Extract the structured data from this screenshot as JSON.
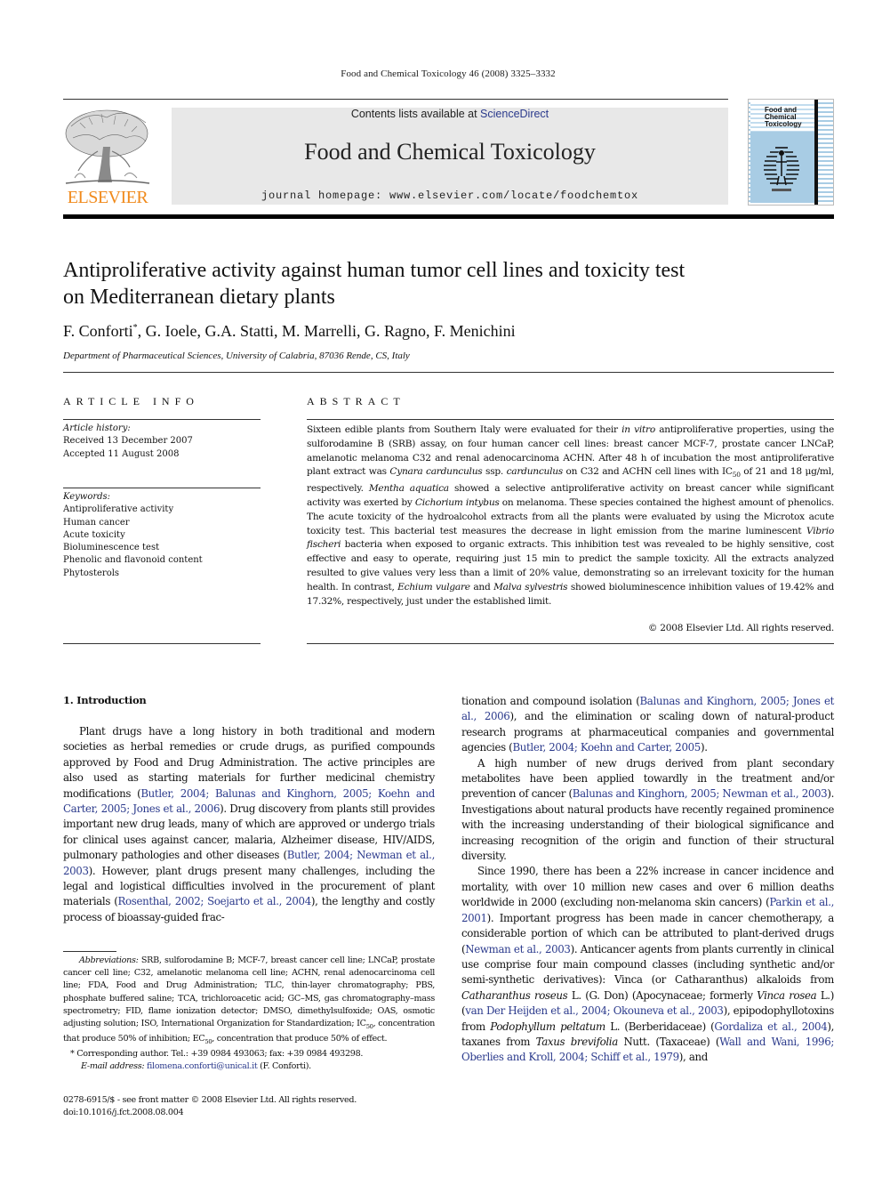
{
  "running_head": "Food and Chemical Toxicology 46 (2008) 3325–3332",
  "masthead": {
    "publisher_logo_text": "ELSEVIER",
    "contents_prefix": "Contents lists available at ",
    "contents_link": "ScienceDirect",
    "journal_title": "Food and Chemical Toxicology",
    "homepage": "journal homepage: www.elsevier.com/locate/foodchemtox",
    "cover_title_lines": [
      "Food and",
      "Chemical",
      "Toxicology"
    ],
    "colors": {
      "elsevier_orange": "#f08a1c",
      "link_blue": "#2b3a8c",
      "cover_blue": "#a8cce4",
      "masthead_gray": "#e8e8e8"
    }
  },
  "article": {
    "title_line1": "Antiproliferative activity against human tumor cell lines and toxicity test",
    "title_line2": "on Mediterranean dietary plants",
    "first_author": "F. Conforti",
    "corresponding_mark": "*",
    "other_authors": ", G. Ioele, G.A. Statti, M. Marrelli, G. Ragno, F. Menichini",
    "affiliation": "Department of Pharmaceutical Sciences, University of Calabria, 87036 Rende, CS, Italy"
  },
  "article_info": {
    "heading": "ARTICLE INFO",
    "history_label": "Article history:",
    "received": "Received 13 December 2007",
    "accepted": "Accepted 11 August 2008",
    "keywords_label": "Keywords:",
    "keywords": [
      "Antiproliferative activity",
      "Human cancer",
      "Acute toxicity",
      "Bioluminescence test",
      "Phenolic and flavonoid content",
      "Phytosterols"
    ]
  },
  "abstract": {
    "heading": "ABSTRACT",
    "segments": [
      {
        "t": "Sixteen edible plants from Southern Italy were evaluated for their "
      },
      {
        "t": "in vitro",
        "i": true
      },
      {
        "t": " antiproliferative properties, using the sulforodamine B (SRB) assay, on four human cancer cell lines: breast cancer MCF-7, prostate cancer LNCaP, amelanotic melanoma C32 and renal adenocarcinoma ACHN. After 48 h of incubation the most antiproliferative plant extract was "
      },
      {
        "t": "Cynara cardunculus",
        "i": true
      },
      {
        "t": " ssp. "
      },
      {
        "t": "cardunculus",
        "i": true
      },
      {
        "t": " on C32 and ACHN cell lines with IC"
      },
      {
        "t": "50",
        "sub": true
      },
      {
        "t": " of 21 and 18 μg/ml, respectively. "
      },
      {
        "t": "Mentha aquatica",
        "i": true
      },
      {
        "t": " showed a selective antiproliferative activity on breast cancer while significant activity was exerted by "
      },
      {
        "t": "Cichorium intybus",
        "i": true
      },
      {
        "t": " on melanoma. These species contained the highest amount of phenolics. The acute toxicity of the hydroalcohol extracts from all the plants were evaluated by using the Microtox acute toxicity test. This bacterial test measures the decrease in light emission from the marine luminescent "
      },
      {
        "t": "Vibrio fischeri",
        "i": true
      },
      {
        "t": " bacteria when exposed to organic extracts. This inhibition test was revealed to be highly sensitive, cost effective and easy to operate, requiring just 15 min to predict the sample toxicity. All the extracts analyzed resulted to give values very less than a limit of 20% value, demonstrating so an irrelevant toxicity for the human health. In contrast, "
      },
      {
        "t": "Echium vulgare",
        "i": true
      },
      {
        "t": " and "
      },
      {
        "t": "Malva sylvestris",
        "i": true
      },
      {
        "t": " showed bioluminescence inhibition values of 19.42% and 17.32%, respectively, just under the established limit."
      }
    ],
    "copyright": "© 2008 Elsevier Ltd. All rights reserved."
  },
  "introduction": {
    "heading": "1. Introduction",
    "left_paragraphs": [
      [
        {
          "t": "Plant drugs have a long history in both traditional and modern societies as herbal remedies or crude drugs, as purified compounds approved by Food and Drug Administration. The active principles are also used as starting materials for further medicinal chemistry modifications ("
        },
        {
          "t": "Butler, 2004; Balunas and Kinghorn, 2005; Koehn and Carter, 2005; Jones et al., 2006",
          "c": true
        },
        {
          "t": "). Drug discovery from plants still provides important new drug leads, many of which are approved or undergo trials for clinical uses against cancer, malaria, Alzheimer disease, HIV/AIDS, pulmonary pathologies and other diseases ("
        },
        {
          "t": "Butler, 2004; Newman et al., 2003",
          "c": true
        },
        {
          "t": "). However, plant drugs present many challenges, including the legal and logistical difficulties involved in the procurement of plant materials ("
        },
        {
          "t": "Rosenthal, 2002; Soejarto et al., 2004",
          "c": true
        },
        {
          "t": "), the lengthy and costly process of bioassay-guided frac-"
        }
      ]
    ],
    "right_paragraphs": [
      {
        "noindent": true,
        "segs": [
          {
            "t": "tionation and compound isolation ("
          },
          {
            "t": "Balunas and Kinghorn, 2005; Jones et al., 2006",
            "c": true
          },
          {
            "t": "), and the elimination or scaling down of natural-product research programs at pharmaceutical companies and governmental agencies ("
          },
          {
            "t": "Butler, 2004; Koehn and Carter, 2005",
            "c": true
          },
          {
            "t": ")."
          }
        ]
      },
      {
        "segs": [
          {
            "t": "A high number of new drugs derived from plant secondary metabolites have been applied towardly in the treatment and/or prevention of cancer ("
          },
          {
            "t": "Balunas and Kinghorn, 2005; Newman et al., 2003",
            "c": true
          },
          {
            "t": "). Investigations about natural products have recently regained prominence with the increasing understanding of their biological significance and increasing recognition of the origin and function of their structural diversity."
          }
        ]
      },
      {
        "segs": [
          {
            "t": "Since 1990, there has been a 22% increase in cancer incidence and mortality, with over 10 million new cases and over 6 million deaths worldwide in 2000 (excluding non-melanoma skin cancers) ("
          },
          {
            "t": "Parkin et al., 2001",
            "c": true
          },
          {
            "t": "). Important progress has been made in cancer chemotherapy, a considerable portion of which can be attributed to plant-derived drugs ("
          },
          {
            "t": "Newman et al., 2003",
            "c": true
          },
          {
            "t": "). Anticancer agents from plants currently in clinical use comprise four main compound classes (including synthetic and/or semi-synthetic derivatives): Vinca (or Catharanthus) alkaloids from "
          },
          {
            "t": "Catharanthus roseus",
            "i": true
          },
          {
            "t": " L. (G. Don) (Apocynaceae; formerly "
          },
          {
            "t": "Vinca rosea",
            "i": true
          },
          {
            "t": " L.) ("
          },
          {
            "t": "van Der Heijden et al., 2004; Okouneva et al., 2003",
            "c": true
          },
          {
            "t": "), epipodophyllotoxins from "
          },
          {
            "t": "Podophyllum peltatum",
            "i": true
          },
          {
            "t": " L. (Berberidaceae) ("
          },
          {
            "t": "Gordaliza et al., 2004",
            "c": true
          },
          {
            "t": "), taxanes from "
          },
          {
            "t": "Taxus brevifolia",
            "i": true
          },
          {
            "t": " Nutt. (Taxaceae) ("
          },
          {
            "t": "Wall and Wani, 1996; Oberlies and Kroll, 2004; Schiff et al., 1979",
            "c": true
          },
          {
            "t": "), and"
          }
        ]
      }
    ]
  },
  "footnotes": {
    "abbreviations_label": "Abbreviations:",
    "abbreviations_segments": [
      {
        "t": " SRB, sulforodamine B; MCF-7, breast cancer cell line; LNCaP, prostate cancer cell line; C32, amelanotic melanoma cell line; ACHN, renal adenocarcinoma cell line; FDA, Food and Drug Administration; TLC, thin-layer chromatography; PBS, phosphate buffered saline; TCA, trichloroacetic acid; GC–MS, gas chromatography–mass spectrometry; FID, flame ionization detector; DMSO, dimethylsulfoxide; OAS, osmotic adjusting solution; ISO, International Organization for Standardization; IC"
      },
      {
        "t": "50",
        "sub": true
      },
      {
        "t": ", concentration that produce 50% of inhibition; EC"
      },
      {
        "t": "50",
        "sub": true
      },
      {
        "t": ", concentration that produce 50% of effect."
      }
    ],
    "corresponding_mark": "*",
    "corresponding": " Corresponding author. Tel.: +39 0984 493063; fax: +39 0984 493298.",
    "email_label": "E-mail address:",
    "email": "filomena.conforti@unical.it",
    "email_suffix": " (F. Conforti)."
  },
  "front_matter": {
    "issn_line": "0278-6915/$ - see front matter © 2008 Elsevier Ltd. All rights reserved.",
    "doi": "doi:10.1016/j.fct.2008.08.004"
  }
}
